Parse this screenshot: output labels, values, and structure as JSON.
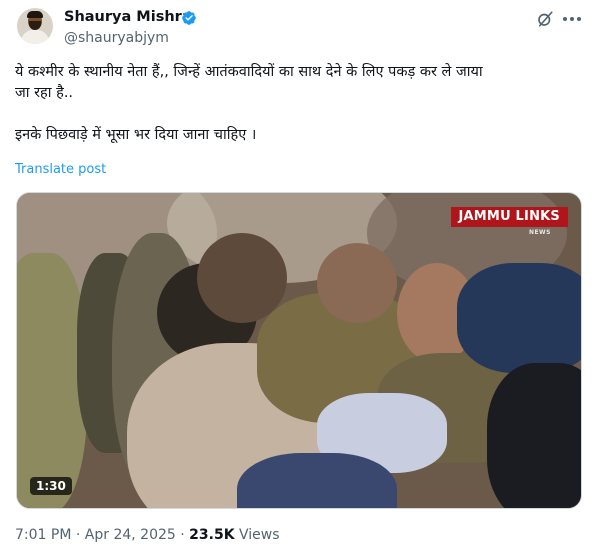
{
  "author": {
    "name": "Shaurya Mishra",
    "handle": "@shauryabjym",
    "verified": true
  },
  "tweet": {
    "text_line1": "ये कश्मीर के स्थानीय नेता हैं,, जिन्हें आतंकवादियों का साथ देने के लिए पकड़ कर ले जाया",
    "text_line2": "जा रहा है..",
    "text_line3": "इनके पिछवाड़े में भूसा भर दिया जाना चाहिए ।",
    "translate_label": "Translate post"
  },
  "video": {
    "watermark": "JAMMU LINKS",
    "watermark_sub": "NEWS",
    "duration": "1:30"
  },
  "meta": {
    "time": "7:01 PM",
    "separator": "·",
    "date": "Apr 24, 2025",
    "views_count": "23.5K",
    "views_label": "Views"
  },
  "colors": {
    "link": "#1d9bf0",
    "verified_badge": "#1d9bf0",
    "secondary_text": "#536471",
    "watermark_bg": "#b0151b"
  },
  "icons": [
    "verified-badge-icon",
    "grok-icon",
    "more-options-icon"
  ]
}
